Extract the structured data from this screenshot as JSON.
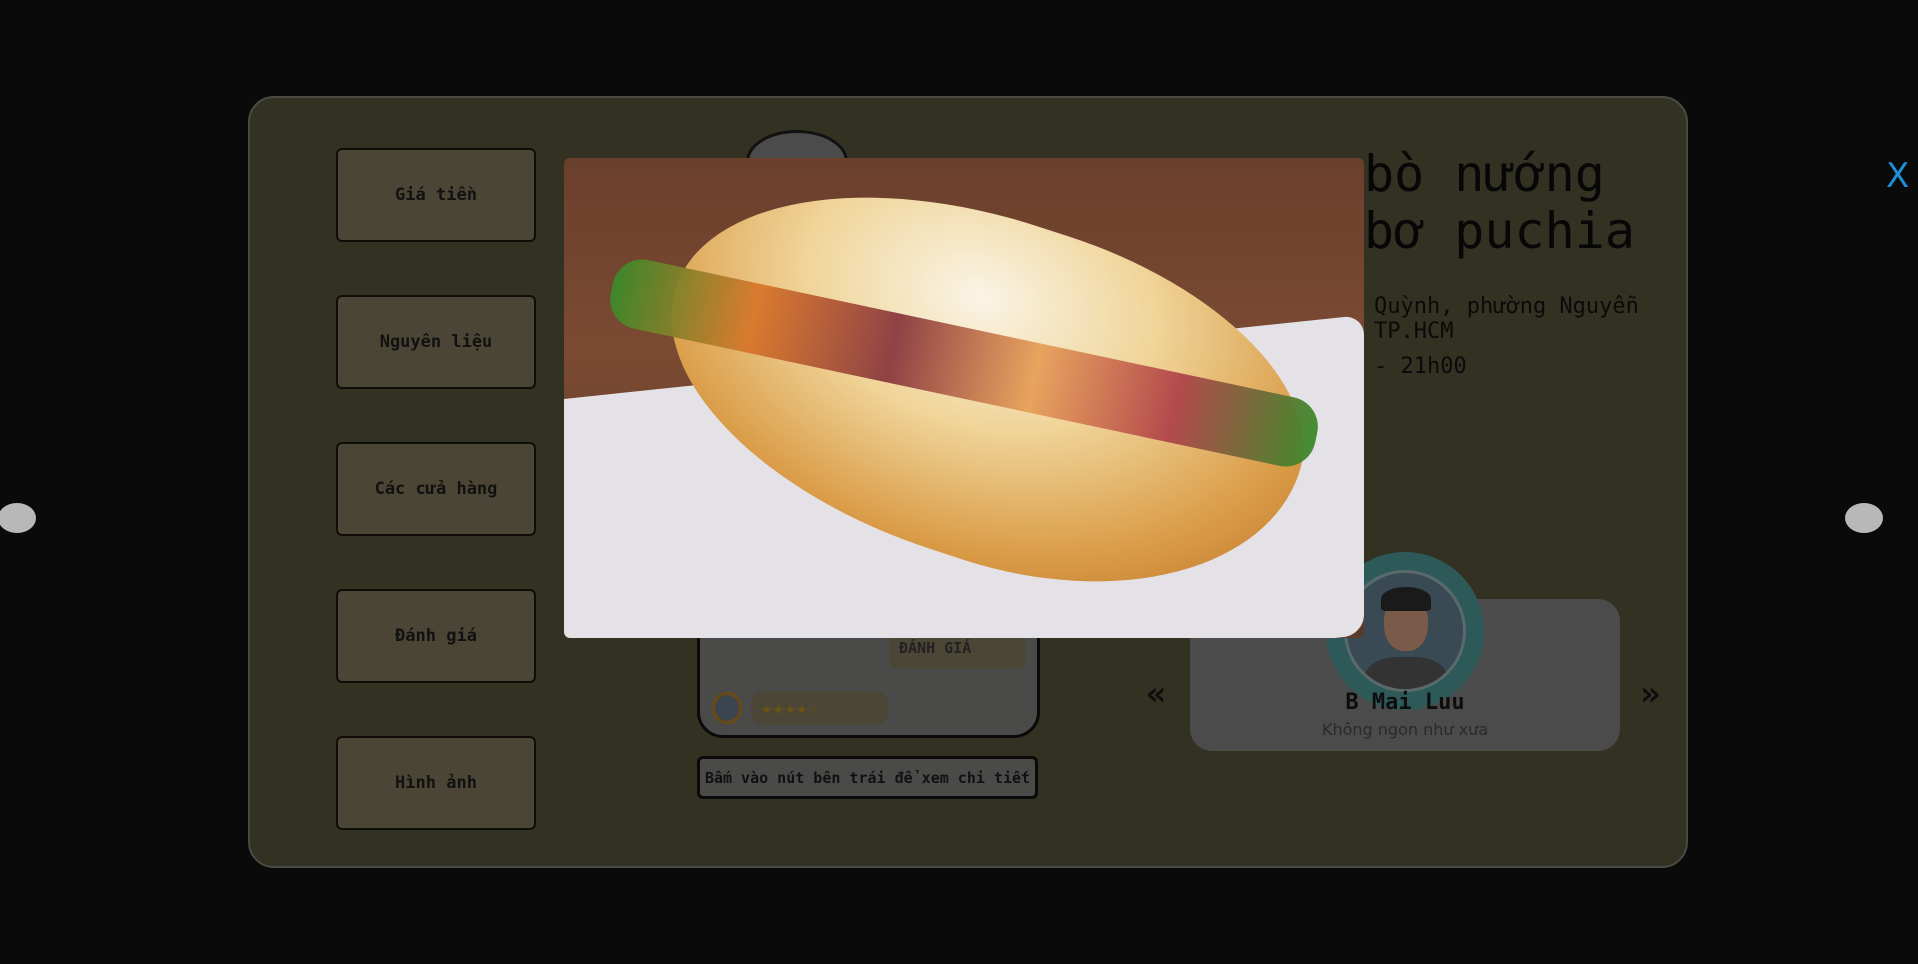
{
  "nav": {
    "items": [
      {
        "label": "Giá tiền"
      },
      {
        "label": "Nguyên liệu"
      },
      {
        "label": "Các cửa hàng"
      },
      {
        "label": "Đánh giá"
      },
      {
        "label": "Hình ảnh"
      }
    ]
  },
  "store": {
    "title": "bò nướng bơ puchia",
    "address": "Quỳnh, phường Nguyễn TP.HCM",
    "hours": "- 21h00"
  },
  "phone": {
    "rate_label": "ĐÁNH GIÁ",
    "stars": "★★★★☆",
    "rating": 4.5
  },
  "hint": "Bấm vào nút bên trái để xem chi tiết",
  "review": {
    "name": "B Mai Luu",
    "text": "Không ngon như xưa",
    "prev": "«",
    "next": "»"
  },
  "lightbox": {
    "close": "X",
    "image": "banh-mi-sandwich-photo"
  },
  "colors": {
    "accent": "#1e8fd6",
    "panel": "#333122"
  }
}
